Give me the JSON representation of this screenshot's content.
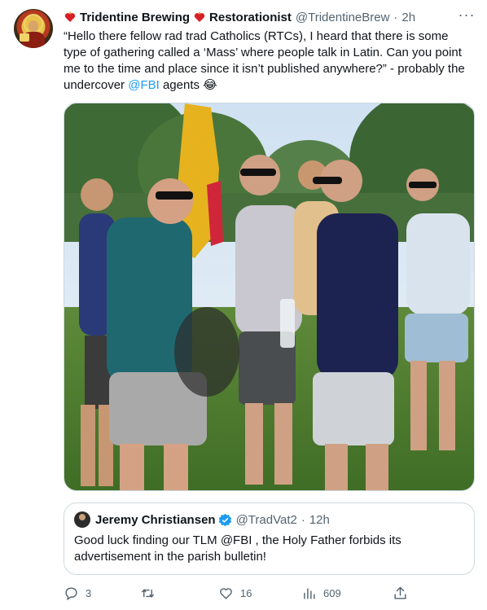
{
  "author": {
    "display_name": "Tridentine Brewing",
    "display_name_suffix": "Restorationist",
    "handle": "@TridentineBrew",
    "time": "2h",
    "separator": "·",
    "avatar_icon": "saint-avatar-icon",
    "name_emoji_icon": "burning-heart-icon"
  },
  "tweet": {
    "text_line1": "“Hello there fellow rad trad Catholics (RTCs), I heard that there is some type of gathering called a ‘Mass’ where people talk in Latin.  Can you point me to the time and place since it isn’t published anywhere?” - probably the undercover ",
    "mention": "@FBI",
    "text_tail": " agents ",
    "emoji": "😂",
    "more_icon": "more-options-icon"
  },
  "photo": {
    "alt": "group of men standing on grass at an outdoor gathering with a yellow flag"
  },
  "quoted": {
    "display_name": "Jeremy Christiansen",
    "handle": "@TradVat2",
    "time": "12h",
    "separator": "·",
    "text_before": "Good luck finding our TLM ",
    "mention": "@FBI",
    "text_after": " , the Holy Father forbids its advertisement in the parish bulletin!",
    "verified_icon": "verified-badge-icon"
  },
  "actions": {
    "replies": "3",
    "retweets": "",
    "likes": "16",
    "views": "609"
  },
  "colors": {
    "text": "#0f1419",
    "secondary": "#536471",
    "link": "#1d9bf0",
    "border": "#cfd9de"
  }
}
